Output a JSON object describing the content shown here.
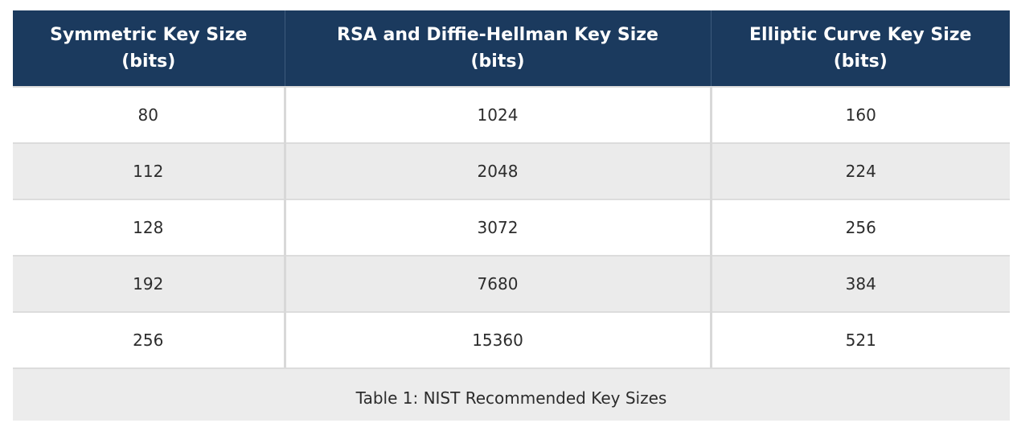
{
  "table": {
    "headers": [
      {
        "line1": "Symmetric Key Size",
        "line2": "(bits)"
      },
      {
        "line1": "RSA and Diffie-Hellman Key Size",
        "line2": "(bits)"
      },
      {
        "line1": "Elliptic Curve Key Size",
        "line2": "(bits)"
      }
    ],
    "rows": [
      [
        "80",
        "1024",
        "160"
      ],
      [
        "112",
        "2048",
        "224"
      ],
      [
        "128",
        "3072",
        "256"
      ],
      [
        "192",
        "7680",
        "384"
      ],
      [
        "256",
        "15360",
        "521"
      ]
    ],
    "caption": "Table 1: NIST Recommended Key Sizes"
  }
}
